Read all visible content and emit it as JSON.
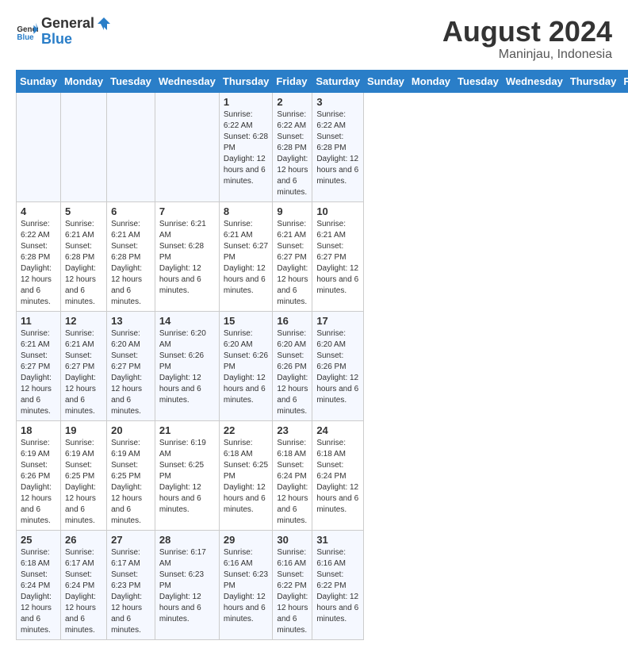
{
  "header": {
    "logo_general": "General",
    "logo_blue": "Blue",
    "month_year": "August 2024",
    "location": "Maninjau, Indonesia"
  },
  "days_of_week": [
    "Sunday",
    "Monday",
    "Tuesday",
    "Wednesday",
    "Thursday",
    "Friday",
    "Saturday"
  ],
  "weeks": [
    [
      {
        "day": "",
        "info": ""
      },
      {
        "day": "",
        "info": ""
      },
      {
        "day": "",
        "info": ""
      },
      {
        "day": "",
        "info": ""
      },
      {
        "day": "1",
        "info": "Sunrise: 6:22 AM\nSunset: 6:28 PM\nDaylight: 12 hours and 6 minutes."
      },
      {
        "day": "2",
        "info": "Sunrise: 6:22 AM\nSunset: 6:28 PM\nDaylight: 12 hours and 6 minutes."
      },
      {
        "day": "3",
        "info": "Sunrise: 6:22 AM\nSunset: 6:28 PM\nDaylight: 12 hours and 6 minutes."
      }
    ],
    [
      {
        "day": "4",
        "info": "Sunrise: 6:22 AM\nSunset: 6:28 PM\nDaylight: 12 hours and 6 minutes."
      },
      {
        "day": "5",
        "info": "Sunrise: 6:21 AM\nSunset: 6:28 PM\nDaylight: 12 hours and 6 minutes."
      },
      {
        "day": "6",
        "info": "Sunrise: 6:21 AM\nSunset: 6:28 PM\nDaylight: 12 hours and 6 minutes."
      },
      {
        "day": "7",
        "info": "Sunrise: 6:21 AM\nSunset: 6:28 PM\nDaylight: 12 hours and 6 minutes."
      },
      {
        "day": "8",
        "info": "Sunrise: 6:21 AM\nSunset: 6:27 PM\nDaylight: 12 hours and 6 minutes."
      },
      {
        "day": "9",
        "info": "Sunrise: 6:21 AM\nSunset: 6:27 PM\nDaylight: 12 hours and 6 minutes."
      },
      {
        "day": "10",
        "info": "Sunrise: 6:21 AM\nSunset: 6:27 PM\nDaylight: 12 hours and 6 minutes."
      }
    ],
    [
      {
        "day": "11",
        "info": "Sunrise: 6:21 AM\nSunset: 6:27 PM\nDaylight: 12 hours and 6 minutes."
      },
      {
        "day": "12",
        "info": "Sunrise: 6:21 AM\nSunset: 6:27 PM\nDaylight: 12 hours and 6 minutes."
      },
      {
        "day": "13",
        "info": "Sunrise: 6:20 AM\nSunset: 6:27 PM\nDaylight: 12 hours and 6 minutes."
      },
      {
        "day": "14",
        "info": "Sunrise: 6:20 AM\nSunset: 6:26 PM\nDaylight: 12 hours and 6 minutes."
      },
      {
        "day": "15",
        "info": "Sunrise: 6:20 AM\nSunset: 6:26 PM\nDaylight: 12 hours and 6 minutes."
      },
      {
        "day": "16",
        "info": "Sunrise: 6:20 AM\nSunset: 6:26 PM\nDaylight: 12 hours and 6 minutes."
      },
      {
        "day": "17",
        "info": "Sunrise: 6:20 AM\nSunset: 6:26 PM\nDaylight: 12 hours and 6 minutes."
      }
    ],
    [
      {
        "day": "18",
        "info": "Sunrise: 6:19 AM\nSunset: 6:26 PM\nDaylight: 12 hours and 6 minutes."
      },
      {
        "day": "19",
        "info": "Sunrise: 6:19 AM\nSunset: 6:25 PM\nDaylight: 12 hours and 6 minutes."
      },
      {
        "day": "20",
        "info": "Sunrise: 6:19 AM\nSunset: 6:25 PM\nDaylight: 12 hours and 6 minutes."
      },
      {
        "day": "21",
        "info": "Sunrise: 6:19 AM\nSunset: 6:25 PM\nDaylight: 12 hours and 6 minutes."
      },
      {
        "day": "22",
        "info": "Sunrise: 6:18 AM\nSunset: 6:25 PM\nDaylight: 12 hours and 6 minutes."
      },
      {
        "day": "23",
        "info": "Sunrise: 6:18 AM\nSunset: 6:24 PM\nDaylight: 12 hours and 6 minutes."
      },
      {
        "day": "24",
        "info": "Sunrise: 6:18 AM\nSunset: 6:24 PM\nDaylight: 12 hours and 6 minutes."
      }
    ],
    [
      {
        "day": "25",
        "info": "Sunrise: 6:18 AM\nSunset: 6:24 PM\nDaylight: 12 hours and 6 minutes."
      },
      {
        "day": "26",
        "info": "Sunrise: 6:17 AM\nSunset: 6:24 PM\nDaylight: 12 hours and 6 minutes."
      },
      {
        "day": "27",
        "info": "Sunrise: 6:17 AM\nSunset: 6:23 PM\nDaylight: 12 hours and 6 minutes."
      },
      {
        "day": "28",
        "info": "Sunrise: 6:17 AM\nSunset: 6:23 PM\nDaylight: 12 hours and 6 minutes."
      },
      {
        "day": "29",
        "info": "Sunrise: 6:16 AM\nSunset: 6:23 PM\nDaylight: 12 hours and 6 minutes."
      },
      {
        "day": "30",
        "info": "Sunrise: 6:16 AM\nSunset: 6:22 PM\nDaylight: 12 hours and 6 minutes."
      },
      {
        "day": "31",
        "info": "Sunrise: 6:16 AM\nSunset: 6:22 PM\nDaylight: 12 hours and 6 minutes."
      }
    ]
  ]
}
